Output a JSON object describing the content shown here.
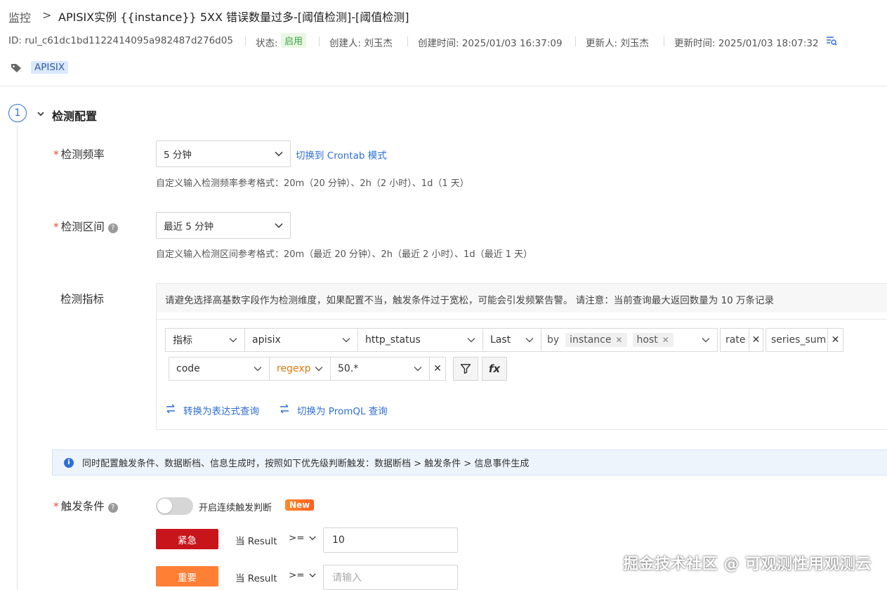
{
  "breadcrumb": {
    "root": "监控",
    "separator": ">",
    "title": "APISIX实例 {{instance}} 5XX 错误数量过多-[阈值检测]-[阈值检测]"
  },
  "meta": {
    "id": "ID: rul_c61dc1bd1122414095a982487d276d05",
    "status_label": "状态:",
    "status_value": "启用",
    "creator": "创建人: 刘玉杰",
    "created_time": "创建时间: 2025/01/03 16:37:09",
    "updater": "更新人: 刘玉杰",
    "updated_time": "更新时间: 2025/01/03 18:07:32"
  },
  "tags": [
    "APISIX"
  ],
  "section": {
    "number": "1",
    "title": "检测配置"
  },
  "frequency": {
    "label": "检测频率",
    "value": "5 分钟",
    "switch_link": "切换到 Crontab 模式",
    "hint": "自定义输入检测频率参考格式：20m（20 分钟）、2h（2 小时）、1d（1 天）"
  },
  "interval": {
    "label": "检测区间",
    "value": "最近 5 分钟",
    "hint": "自定义输入检测区间参考格式：20m（最近 20 分钟）、2h（最近 2 小时）、1d（最近 1 天）"
  },
  "metric": {
    "label": "检测指标",
    "notice": "请避免选择高基数字段作为检测维度，如果配置不当，触发条件过于宽松，可能会引发频繁告警。 请注意：当前查询最大返回数量为 10 万条记录",
    "type": "指标",
    "source": "apisix",
    "field": "http_status",
    "agg": "Last",
    "by": "by",
    "group_by": [
      "instance",
      "host"
    ],
    "funcs": [
      "rate",
      "series_sum"
    ],
    "filter": {
      "key": "code",
      "op": "regexp",
      "value": "50.*"
    },
    "fx": "fx",
    "expr_link": "转换为表达式查询",
    "promql_link": "切换为 PromQL 查询"
  },
  "info": "同时配置触发条件、数据断档、信息生成时，按照如下优先级判断触发：数据断档 > 触发条件 > 信息事件生成",
  "trigger": {
    "label": "触发条件",
    "toggle_label": "开启连续触发判断",
    "new_badge": "New",
    "rules": [
      {
        "level": "紧急",
        "color": "#c8151b",
        "when": "当 Result",
        "op": ">=",
        "value": "10",
        "placeholder": ""
      },
      {
        "level": "重要",
        "color": "#ff7f35",
        "when": "当 Result",
        "op": ">=",
        "value": "",
        "placeholder": "请输入"
      }
    ]
  },
  "watermark": "掘金技术社区 @ 可观测性用观测云"
}
